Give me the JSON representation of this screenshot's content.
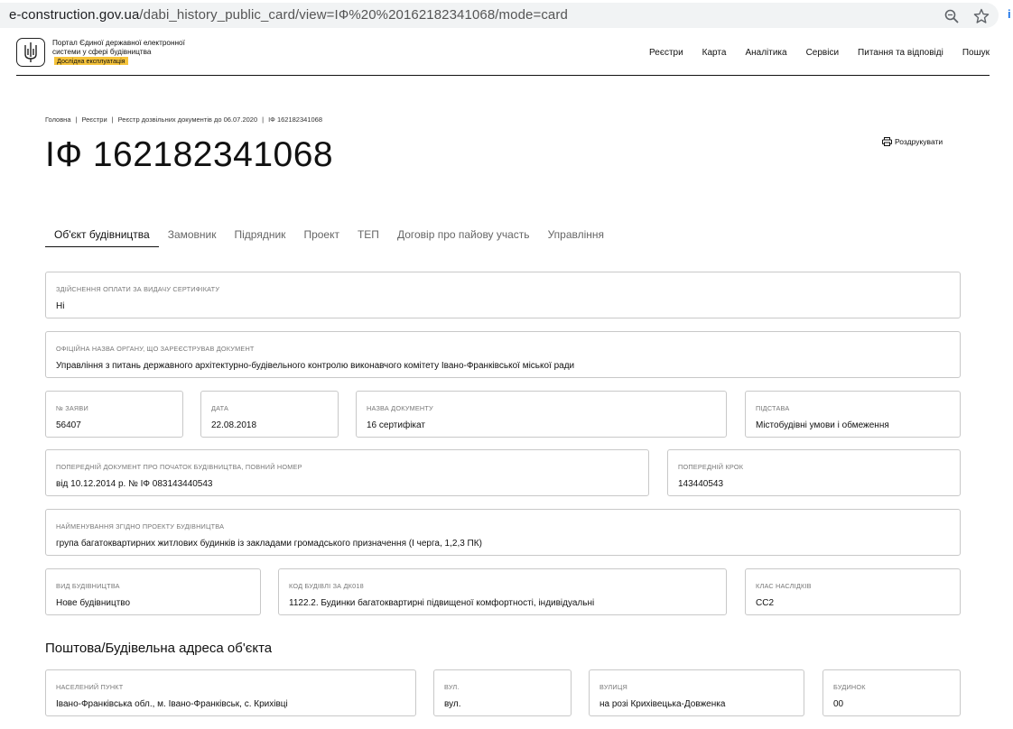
{
  "browser": {
    "url_host": "e-construction.gov.ua",
    "url_path": "/dabi_history_public_card/view=ІФ%20%20162182341068/mode=card"
  },
  "header": {
    "portal_title": "Портал Єдиної державної електронної системи у сфері будівництва",
    "beta_badge": "Дослідна експлуатація",
    "nav": [
      "Реєстри",
      "Карта",
      "Аналітика",
      "Сервіси",
      "Питання та відповіді",
      "Пошук"
    ]
  },
  "breadcrumb": [
    "Головна",
    "Реєстри",
    "Реєстр дозвільних документів до 06.07.2020",
    "ІФ 162182341068"
  ],
  "page_title": "ІФ 162182341068",
  "print_label": "Роздрукувати",
  "tabs": [
    "Об'єкт будівництва",
    "Замовник",
    "Підрядник",
    "Проект",
    "ТЕП",
    "Договір про пайову участь",
    "Управління"
  ],
  "fields": {
    "payment": {
      "label": "Здійснення оплати за видачу сертифікату",
      "value": "Ні"
    },
    "authority": {
      "label": "Офіційна назва органу, що зареєстрував документ",
      "value": "Управління з питань державного архітектурно-будівельного контролю виконавчого комітету Івано-Франківської міської ради"
    },
    "application_no": {
      "label": "№ заяви",
      "value": "56407"
    },
    "date": {
      "label": "Дата",
      "value": "22.08.2018"
    },
    "doc_name": {
      "label": "Назва документу",
      "value": "16 сертифікат"
    },
    "basis": {
      "label": "Підстава",
      "value": "Містобудівні умови і обмеження"
    },
    "prev_doc": {
      "label": "Попередній документ про початок будівництва, повний номер",
      "value": "від 10.12.2014 р. № ІФ 083143440543"
    },
    "prev_step": {
      "label": "Попередній крок",
      "value": "143440543"
    },
    "project_name": {
      "label": "Найменування згідно проекту будівництва",
      "value": "група багатоквартирних житлових будинків із закладами громадського призначення (І черга, 1,2,3 ПК)"
    },
    "construction_type": {
      "label": "Вид будівництва",
      "value": "Нове будівництво"
    },
    "building_code": {
      "label": "Код будівлі за ДК018",
      "value": "1122.2. Будинки багатоквартирні підвищеної комфортності, індивідуальні"
    },
    "consequence_class": {
      "label": "Клас наслідків",
      "value": "СС2"
    }
  },
  "address_section_title": "Поштова/Будівельна адреса об'єкта",
  "address": {
    "settlement": {
      "label": "Населений пункт",
      "value": "Івано-Франківська обл., м. Івано-Франківськ, с. Крихівці"
    },
    "street_type": {
      "label": "Вул.",
      "value": "вул."
    },
    "street": {
      "label": "Вулиця",
      "value": "на розі Крихівецька-Довженка"
    },
    "building": {
      "label": "Будинок",
      "value": "00"
    }
  }
}
